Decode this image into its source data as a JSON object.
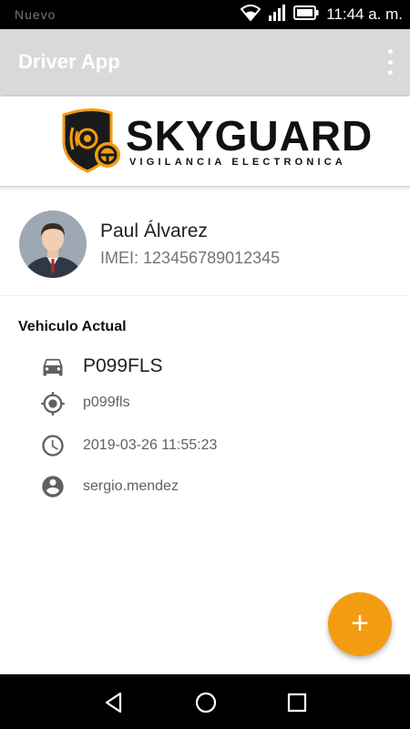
{
  "status_bar": {
    "left_text": "Nuevo",
    "time": "11:44 a. m."
  },
  "app_bar": {
    "title": "Driver App",
    "overflow_icon": "more-vert-icon"
  },
  "logo": {
    "brand": "SKYGUARD",
    "tagline": "VIGILANCIA ELECTRONICA"
  },
  "driver": {
    "name": "Paul Álvarez",
    "imei": "IMEI: 123456789012345"
  },
  "vehicle": {
    "section_title": "Vehiculo Actual",
    "plate": "P099FLS",
    "device": "p099fls",
    "timestamp": "2019-03-26 11:55:23",
    "user": "sergio.mendez"
  },
  "fab": {
    "label": "+"
  },
  "colors": {
    "accent": "#f39c12",
    "app_bar": "#d9d9d9"
  },
  "icons": [
    "car-icon",
    "gps-fixed-icon",
    "clock-icon",
    "account-circle-icon"
  ]
}
